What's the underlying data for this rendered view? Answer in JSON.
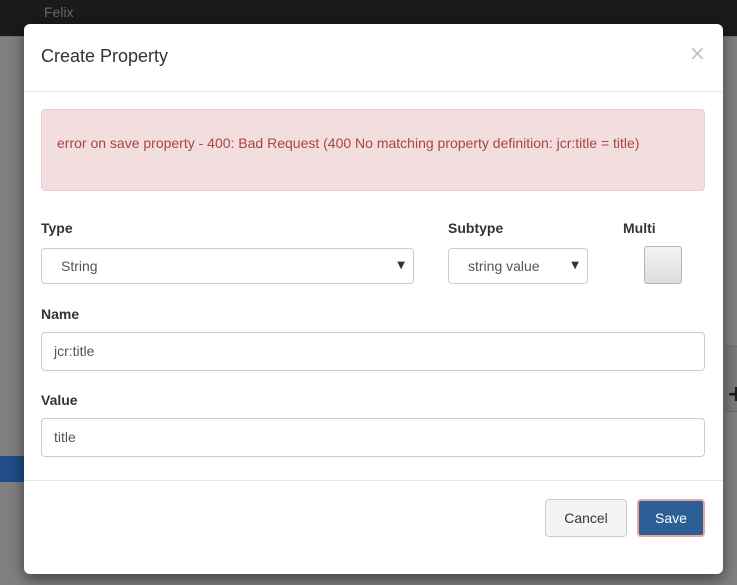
{
  "background": {
    "brand": "Felix"
  },
  "modal": {
    "title": "Create Property",
    "close_glyph": "×",
    "alert_text": "error on save property - 400: Bad Request (400 No matching property definition: jcr:title = title)",
    "type": {
      "label": "Type",
      "value": "String"
    },
    "subtype": {
      "label": "Subtype",
      "value": "string value"
    },
    "multi": {
      "label": "Multi",
      "checked": false
    },
    "name": {
      "label": "Name",
      "value": "jcr:title"
    },
    "value_field": {
      "label": "Value",
      "value": "title"
    },
    "footer": {
      "cancel_label": "Cancel",
      "save_label": "Save"
    }
  },
  "icons": {
    "close": "close-icon",
    "caret": "chevron-down-icon",
    "plus": "plus-icon"
  },
  "colors": {
    "alert_bg": "#f2dede",
    "alert_text": "#a94442",
    "primary": "#2c5f96"
  }
}
